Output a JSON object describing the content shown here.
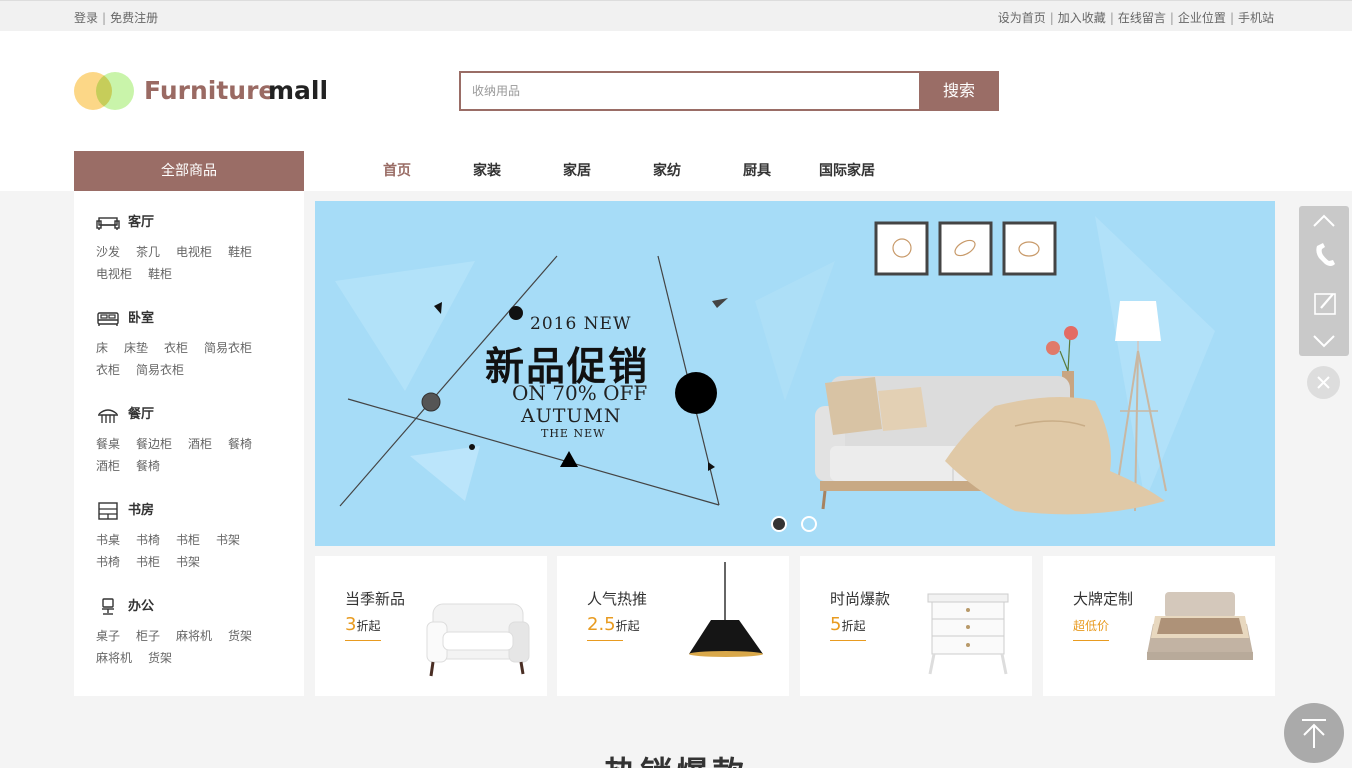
{
  "topbar": {
    "login": "登录",
    "register": "免费注册",
    "set_home": "设为首页",
    "favorite": "加入收藏",
    "message": "在线留言",
    "location": "企业位置",
    "mobile": "手机站"
  },
  "logo": {
    "word1": "Furniture",
    "word2": "mall"
  },
  "search": {
    "placeholder": "收纳用品",
    "button": "搜索"
  },
  "all_goods": "全部商品",
  "nav": [
    "首页",
    "家装",
    "家居",
    "家纺",
    "厨具",
    "国际家居"
  ],
  "sidebar": {
    "categories": [
      {
        "name": "客厅",
        "icon": "sofa-icon",
        "links": [
          "沙发",
          "茶几",
          "电视柜",
          "鞋柜",
          "电视柜",
          "鞋柜"
        ]
      },
      {
        "name": "卧室",
        "icon": "bed-icon",
        "links": [
          "床",
          "床垫",
          "衣柜",
          "简易衣柜",
          "衣柜",
          "简易衣柜"
        ]
      },
      {
        "name": "餐厅",
        "icon": "dining-icon",
        "links": [
          "餐桌",
          "餐边柜",
          "酒柜",
          "餐椅",
          "酒柜",
          "餐椅"
        ]
      },
      {
        "name": "书房",
        "icon": "bookshelf-icon",
        "links": [
          "书桌",
          "书椅",
          "书柜",
          "书架",
          "书椅",
          "书柜",
          "书架"
        ]
      },
      {
        "name": "办公",
        "icon": "office-chair-icon",
        "links": [
          "桌子",
          "柜子",
          "麻将机",
          "货架",
          "麻将机",
          "货架"
        ]
      }
    ]
  },
  "banner": {
    "line1": "2016 NEW",
    "line2": "新品促销",
    "line3": "ON 70% OFF",
    "line4": "AUTUMN",
    "line5": "THE NEW"
  },
  "cards": [
    {
      "title": "当季新品",
      "num": "3",
      "suffix": "折起"
    },
    {
      "title": "人气热推",
      "num": "2.5",
      "suffix": "折起"
    },
    {
      "title": "时尚爆款",
      "num": "5",
      "suffix": "折起"
    },
    {
      "title": "大牌定制",
      "num": "",
      "suffix": "超低价"
    }
  ],
  "section_title": "热销爆款",
  "colors": {
    "brand": "#9a6d66",
    "accent": "#e89b20",
    "banner_bg": "#a6dcf7"
  }
}
